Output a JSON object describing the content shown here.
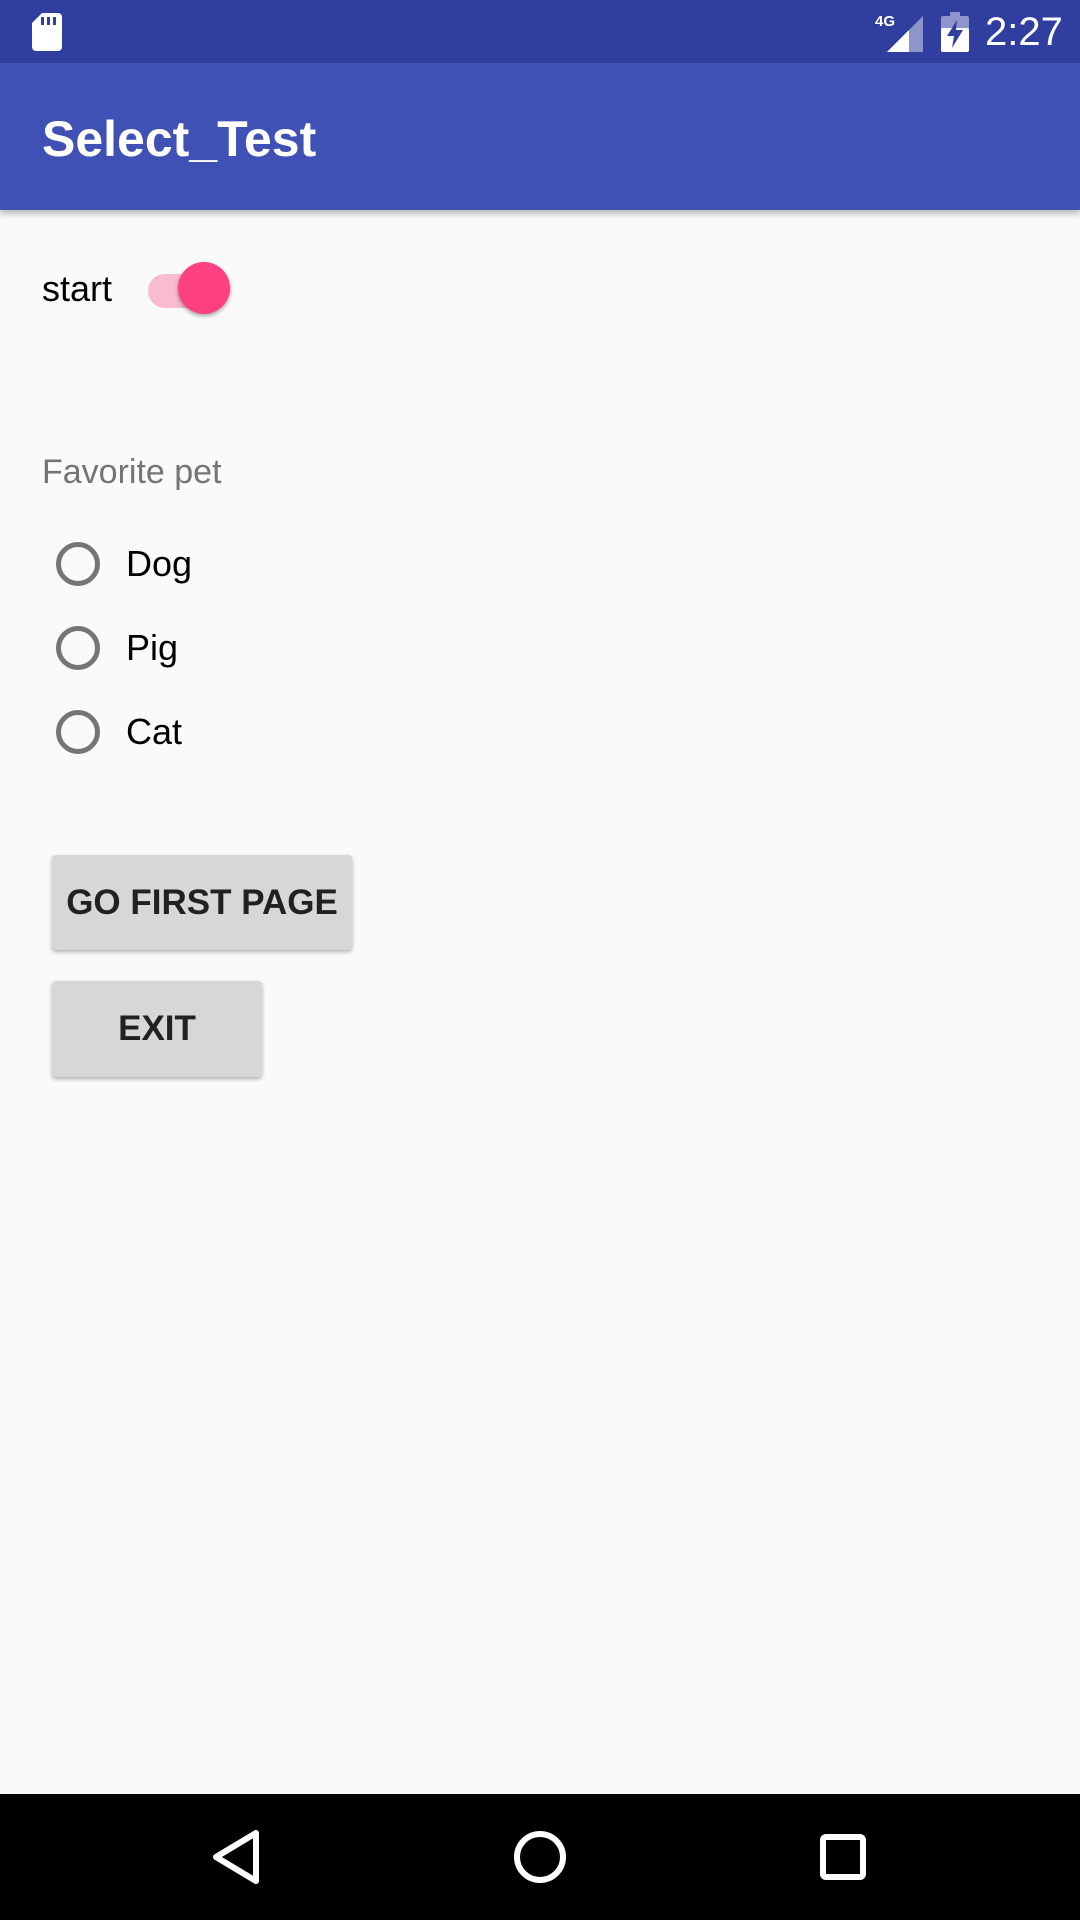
{
  "status_bar": {
    "time": "2:27",
    "network": "4G",
    "icons": [
      "sd-card-icon",
      "signal-icon",
      "battery-charging-icon"
    ]
  },
  "app_bar": {
    "title": "Select_Test"
  },
  "switch": {
    "label": "start",
    "checked": true
  },
  "radio_group": {
    "label": "Favorite pet",
    "options": [
      "Dog",
      "Pig",
      "Cat"
    ],
    "selected": null
  },
  "buttons": {
    "go_first_page": "GO FIRST PAGE",
    "exit": "EXIT"
  },
  "nav_bar": {
    "icons": [
      "back-icon",
      "home-icon",
      "recents-icon"
    ]
  },
  "colors": {
    "status_bar": "#303f9f",
    "app_bar": "#3f51b5",
    "accent": "#ff4081",
    "accent_track": "#f8bbd0",
    "button": "#d6d7d7",
    "background": "#fafafa"
  }
}
